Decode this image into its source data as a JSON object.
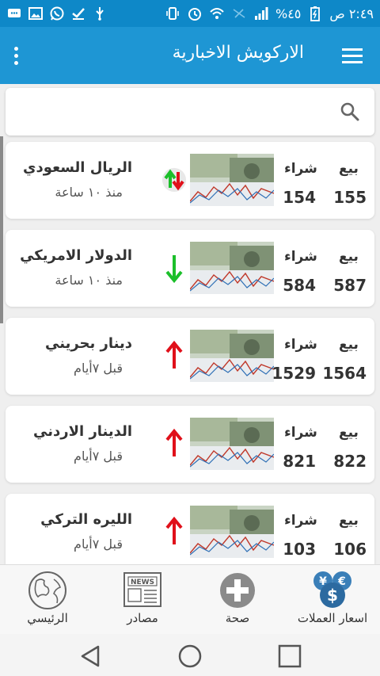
{
  "status_bar": {
    "time": "٢:٤٩ ص",
    "battery": "٤٥%"
  },
  "app": {
    "title": "الاركويش الاخبارية"
  },
  "search": {
    "placeholder": ""
  },
  "columns": {
    "sell": "بيع",
    "buy": "شراء"
  },
  "currencies": [
    {
      "name": "الريال السعودي",
      "time": "منذ ١٠ ساعة",
      "buy": "154",
      "sell": "155",
      "trend": "up-down"
    },
    {
      "name": "الدولار الامريكي",
      "time": "منذ ١٠ ساعة",
      "buy": "584",
      "sell": "587",
      "trend": "down"
    },
    {
      "name": "دينار بحريني",
      "time": "قبل ٧أيام",
      "buy": "1529",
      "sell": "1564",
      "trend": "up"
    },
    {
      "name": "الدينار الاردني",
      "time": "قبل ٧أيام",
      "buy": "821",
      "sell": "822",
      "trend": "up"
    },
    {
      "name": "الليره التركي",
      "time": "قبل ٧أيام",
      "buy": "103",
      "sell": "106",
      "trend": "up"
    }
  ],
  "bottom_nav": {
    "home": "الرئيسي",
    "sources": "مصادر",
    "health": "صحة",
    "prices": "اسعار العملات",
    "news_icon_text": "NEWS"
  },
  "colors": {
    "primary": "#1e96d4",
    "status_bar": "#0e88c8",
    "up": "#e0101a",
    "down": "#1bbf2a"
  }
}
